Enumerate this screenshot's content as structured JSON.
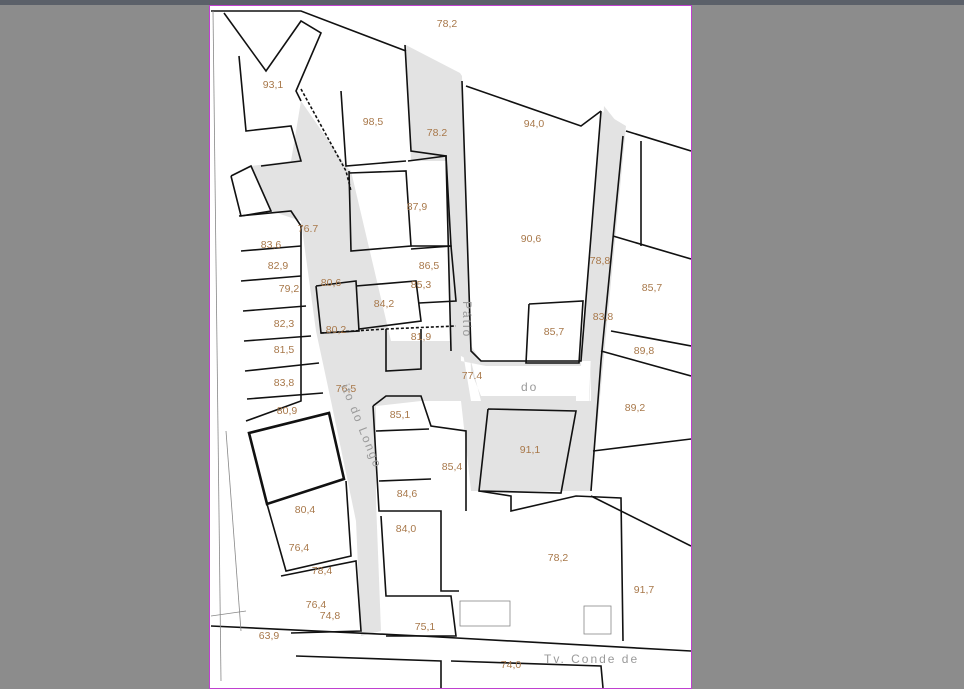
{
  "viewer": {
    "accent_border": "#c040d0",
    "background": "#8c8c8c"
  },
  "map": {
    "elevations": [
      "78,2",
      "93,1",
      "98,5",
      "78.2",
      "94,0",
      "87,9",
      "76.7",
      "90,6",
      "83,6",
      "82,9",
      "86,5",
      "78,8",
      "85,7",
      "80,6",
      "85,3",
      "79,2",
      "84,2",
      "82,3",
      "80,2",
      "81,9",
      "85,7",
      "83,8",
      "81,5",
      "89,8",
      "77.4",
      "83,8",
      "76,5",
      "85,1",
      "89,2",
      "80,9",
      "91,1",
      "85,4",
      "84,6",
      "80,4",
      "84,0",
      "78,2",
      "76,4",
      "78,4",
      "91,7",
      "76,4",
      "74,8",
      "75,1",
      "63,9",
      "74,0"
    ],
    "streets": {
      "patio_vertical": "Pátio",
      "patio_do": "do",
      "patio_do_longo": "ito do Longo",
      "travessa": "Tv.  Conde  de"
    },
    "colors": {
      "label": "#a8784a",
      "public_space": "#e3e3e3"
    }
  }
}
